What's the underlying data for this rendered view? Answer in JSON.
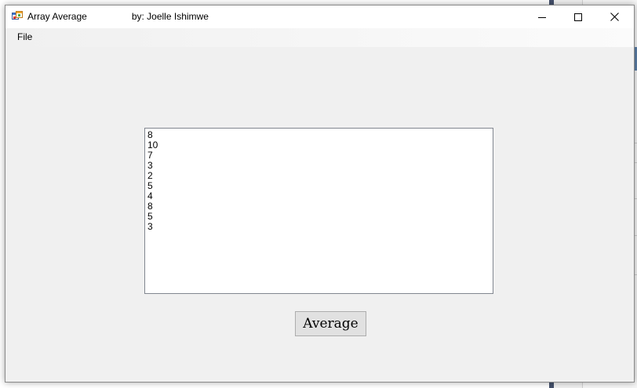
{
  "window": {
    "title": "Array Average",
    "author_label": "by: Joelle Ishimwe",
    "controls": {
      "minimize_icon": "minimize-icon",
      "maximize_icon": "maximize-icon",
      "close_icon": "close-icon"
    }
  },
  "menubar": {
    "items": [
      {
        "label": "File"
      }
    ]
  },
  "listbox": {
    "items": [
      "8",
      "10",
      "7",
      "3",
      "2",
      "5",
      "4",
      "8",
      "5",
      "3"
    ]
  },
  "actions": {
    "average_label": "Average"
  },
  "colors": {
    "window_bg": "#f0f0f0",
    "titlebar_bg": "#ffffff",
    "listbox_bg": "#ffffff",
    "button_bg": "#e1e1e1",
    "button_border": "#adadad"
  }
}
